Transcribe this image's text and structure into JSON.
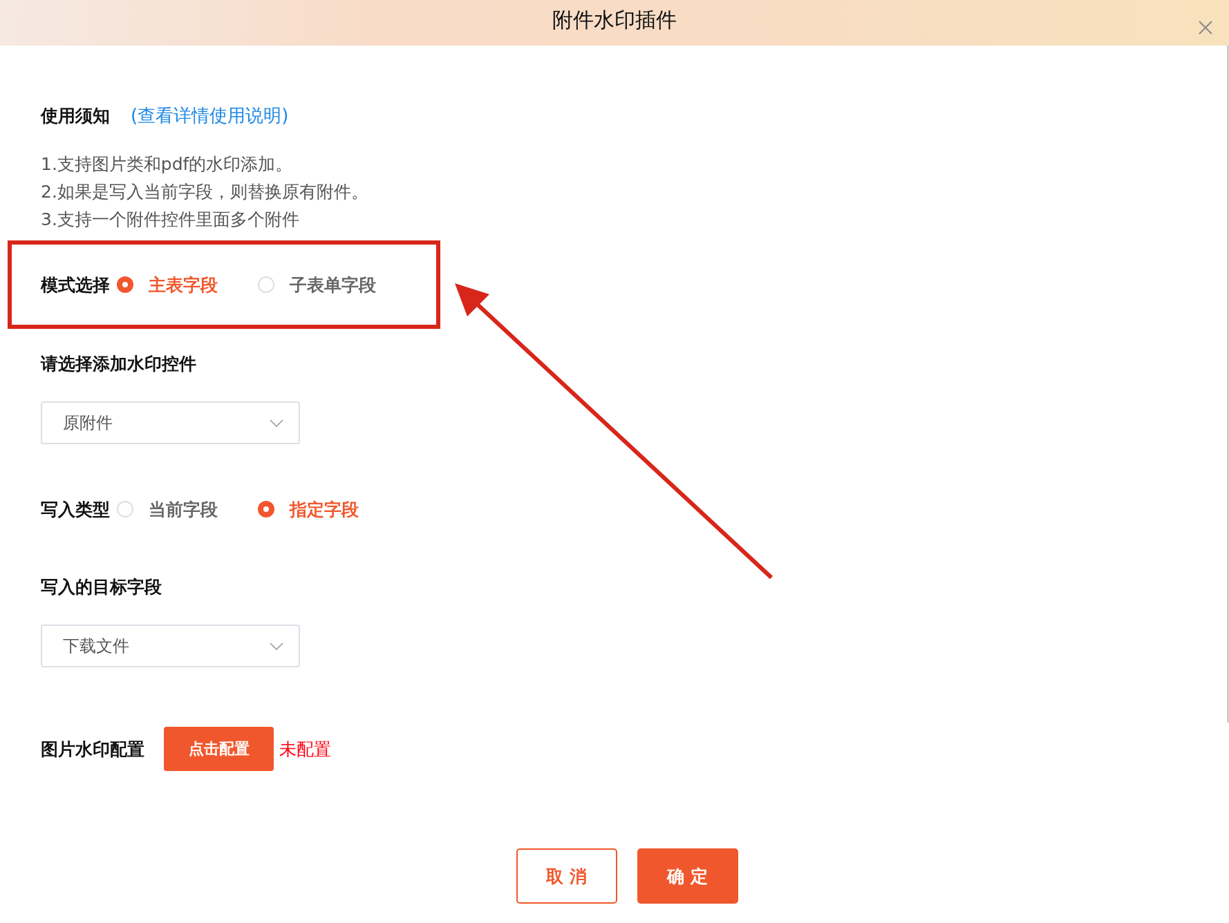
{
  "window": {
    "title": "附件水印插件"
  },
  "notice": {
    "label": "使用须知",
    "link": "(查看详情使用说明)",
    "lines": [
      "1.支持图片类和pdf的水印添加。",
      "2.如果是写入当前字段，则替换原有附件。",
      "3.支持一个附件控件里面多个附件"
    ]
  },
  "mode": {
    "label": "模式选择",
    "options": [
      {
        "label": "主表字段",
        "selected": true
      },
      {
        "label": "子表单字段",
        "selected": false
      }
    ]
  },
  "control_select": {
    "label": "请选择添加水印控件",
    "value": "原附件"
  },
  "write_type": {
    "label": "写入类型",
    "options": [
      {
        "label": "当前字段",
        "selected": false
      },
      {
        "label": "指定字段",
        "selected": true
      }
    ]
  },
  "target_select": {
    "label": "写入的目标字段",
    "value": "下载文件"
  },
  "image_watermark": {
    "label": "图片水印配置",
    "button": "点击配置",
    "status": "未配置"
  },
  "buttons": [
    {
      "label": "取 消",
      "kind": "secondary"
    },
    {
      "label": "确 定",
      "kind": "primary"
    }
  ]
}
